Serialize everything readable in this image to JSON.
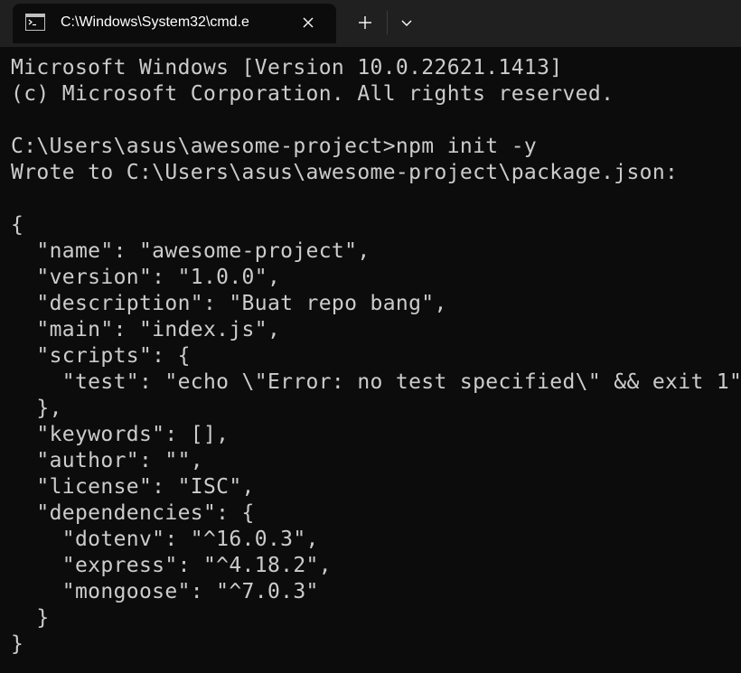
{
  "window": {
    "tab_title": "C:\\Windows\\System32\\cmd.e",
    "tab_icon": "command-prompt-icon",
    "close_icon": "close-icon",
    "new_tab_icon": "plus-icon",
    "dropdown_icon": "chevron-down-icon"
  },
  "colors": {
    "background": "#0c0c0c",
    "tabbar": "#202020",
    "text": "#cccccc"
  },
  "terminal": {
    "lines": [
      "Microsoft Windows [Version 10.0.22621.1413]",
      "(c) Microsoft Corporation. All rights reserved.",
      "",
      "C:\\Users\\asus\\awesome-project>npm init -y",
      "Wrote to C:\\Users\\asus\\awesome-project\\package.json:",
      "",
      "{",
      "  \"name\": \"awesome-project\",",
      "  \"version\": \"1.0.0\",",
      "  \"description\": \"Buat repo bang\",",
      "  \"main\": \"index.js\",",
      "  \"scripts\": {",
      "    \"test\": \"echo \\\"Error: no test specified\\\" && exit 1\"",
      "  },",
      "  \"keywords\": [],",
      "  \"author\": \"\",",
      "  \"license\": \"ISC\",",
      "  \"dependencies\": {",
      "    \"dotenv\": \"^16.0.3\",",
      "    \"express\": \"^4.18.2\",",
      "    \"mongoose\": \"^7.0.3\"",
      "  }",
      "}"
    ]
  }
}
